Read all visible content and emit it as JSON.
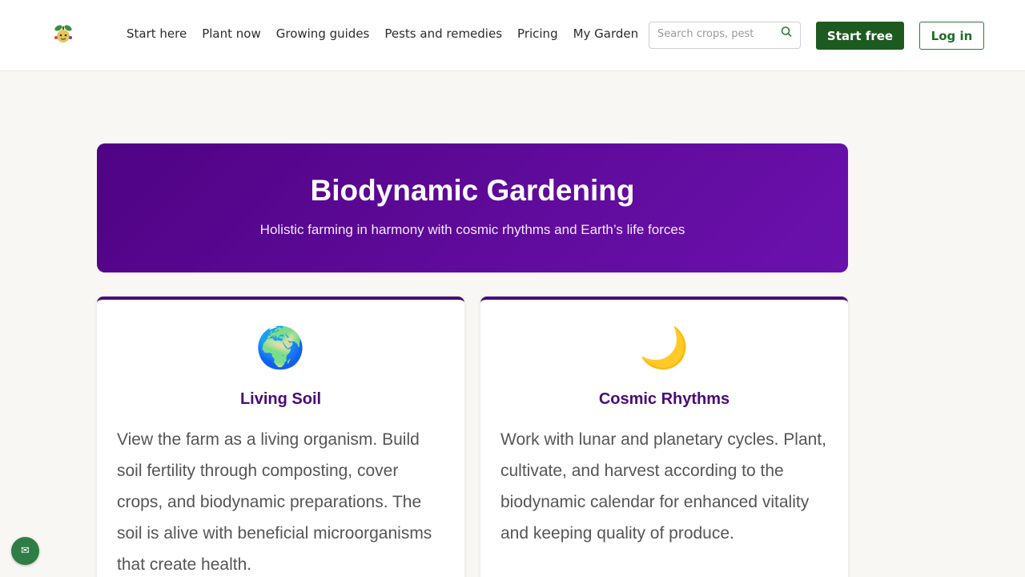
{
  "header": {
    "logo_icon": "sprout-mascot-icon",
    "nav": [
      {
        "label": "Start here"
      },
      {
        "label": "Plant now"
      },
      {
        "label": "Growing guides"
      },
      {
        "label": "Pests and remedies"
      },
      {
        "label": "Pricing"
      },
      {
        "label": "My Garden"
      }
    ],
    "search": {
      "placeholder": "Search crops, pest",
      "value": "",
      "icon": "search-icon"
    },
    "start_free_label": "Start free",
    "login_label": "Log in"
  },
  "hero": {
    "title": "Biodynamic Gardening",
    "subtitle": "Holistic farming in harmony with cosmic rhythms and Earth’s life forces"
  },
  "cards": [
    {
      "emoji": "🌍",
      "title": "Living Soil",
      "text": "View the farm as a living organism. Build soil fertility through composting, cover crops, and biodynamic preparations. The soil is alive with beneficial microorganisms that create health."
    },
    {
      "emoji": "🌙",
      "title": "Cosmic Rhythms",
      "text": "Work with lunar and planetary cycles. Plant, cultivate, and harvest according to the biodynamic calendar for enhanced vitality and keeping quality of produce."
    }
  ],
  "chat_widget": {
    "icon": "envelope-icon",
    "glyph": "✉"
  },
  "colors": {
    "brand_green": "#1d5a1f",
    "hero_purple": "#5e0a99",
    "card_title_purple": "#4a0a78",
    "page_background": "#f8f7f3"
  }
}
